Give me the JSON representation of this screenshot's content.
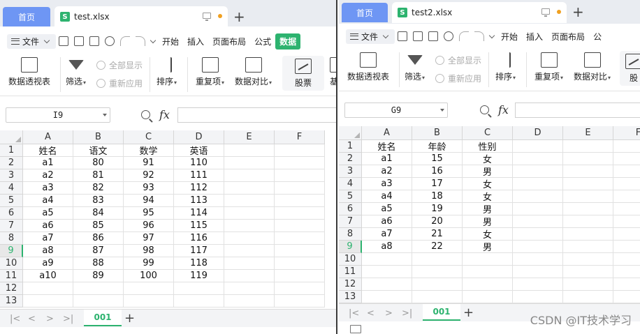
{
  "colors": {
    "accent": "#2db36f",
    "home_tab": "#6e96f4"
  },
  "left": {
    "home_tab": "首页",
    "file_tab": "test.xlsx",
    "menu": {
      "file": "文件",
      "items": [
        "开始",
        "插入",
        "页面布局",
        "公式",
        "数据"
      ],
      "active": "数据"
    },
    "ribbon": {
      "pivot": "数据透视表",
      "filter": "筛选",
      "show_all": "全部显示",
      "reapply": "重新应用",
      "sort": "排序",
      "duplicates": "重复项",
      "compare": "数据对比",
      "stock": "股票",
      "cut": "基"
    },
    "name_box": "I9",
    "fx": "fx",
    "columns": [
      "A",
      "B",
      "C",
      "D",
      "E",
      "F"
    ],
    "rows": [
      "1",
      "2",
      "3",
      "4",
      "5",
      "6",
      "7",
      "8",
      "9",
      "10",
      "11",
      "12",
      "13"
    ],
    "selected_row": "9",
    "cells": [
      [
        "姓名",
        "语文",
        "数学",
        "英语"
      ],
      [
        "a1",
        "80",
        "91",
        "110"
      ],
      [
        "a2",
        "81",
        "92",
        "111"
      ],
      [
        "a3",
        "82",
        "93",
        "112"
      ],
      [
        "a4",
        "83",
        "94",
        "113"
      ],
      [
        "a5",
        "84",
        "95",
        "114"
      ],
      [
        "a6",
        "85",
        "96",
        "115"
      ],
      [
        "a7",
        "86",
        "97",
        "116"
      ],
      [
        "a8",
        "87",
        "98",
        "117"
      ],
      [
        "a9",
        "88",
        "99",
        "118"
      ],
      [
        "a10",
        "89",
        "100",
        "119"
      ]
    ],
    "sheet": "001"
  },
  "right": {
    "home_tab": "首页",
    "file_tab": "test2.xlsx",
    "menu": {
      "file": "文件",
      "items": [
        "开始",
        "插入",
        "页面布局",
        "公"
      ]
    },
    "ribbon": {
      "pivot": "数据透视表",
      "filter": "筛选",
      "show_all": "全部显示",
      "reapply": "重新应用",
      "sort": "排序",
      "duplicates": "重复项",
      "compare": "数据对比",
      "stock": "股"
    },
    "name_box": "G9",
    "fx": "fx",
    "columns": [
      "A",
      "B",
      "C",
      "D",
      "E",
      "F"
    ],
    "rows": [
      "1",
      "2",
      "3",
      "4",
      "5",
      "6",
      "7",
      "8",
      "9",
      "10",
      "11",
      "12",
      "13"
    ],
    "selected_row": "9",
    "cells": [
      [
        "姓名",
        "年龄",
        "性别"
      ],
      [
        "a1",
        "15",
        "女"
      ],
      [
        "a2",
        "16",
        "男"
      ],
      [
        "a3",
        "17",
        "女"
      ],
      [
        "a4",
        "18",
        "女"
      ],
      [
        "a5",
        "19",
        "男"
      ],
      [
        "a6",
        "20",
        "男"
      ],
      [
        "a7",
        "21",
        "女"
      ],
      [
        "a8",
        "22",
        "男"
      ]
    ],
    "sheet": "001"
  },
  "watermark": "CSDN @IT技术学习"
}
